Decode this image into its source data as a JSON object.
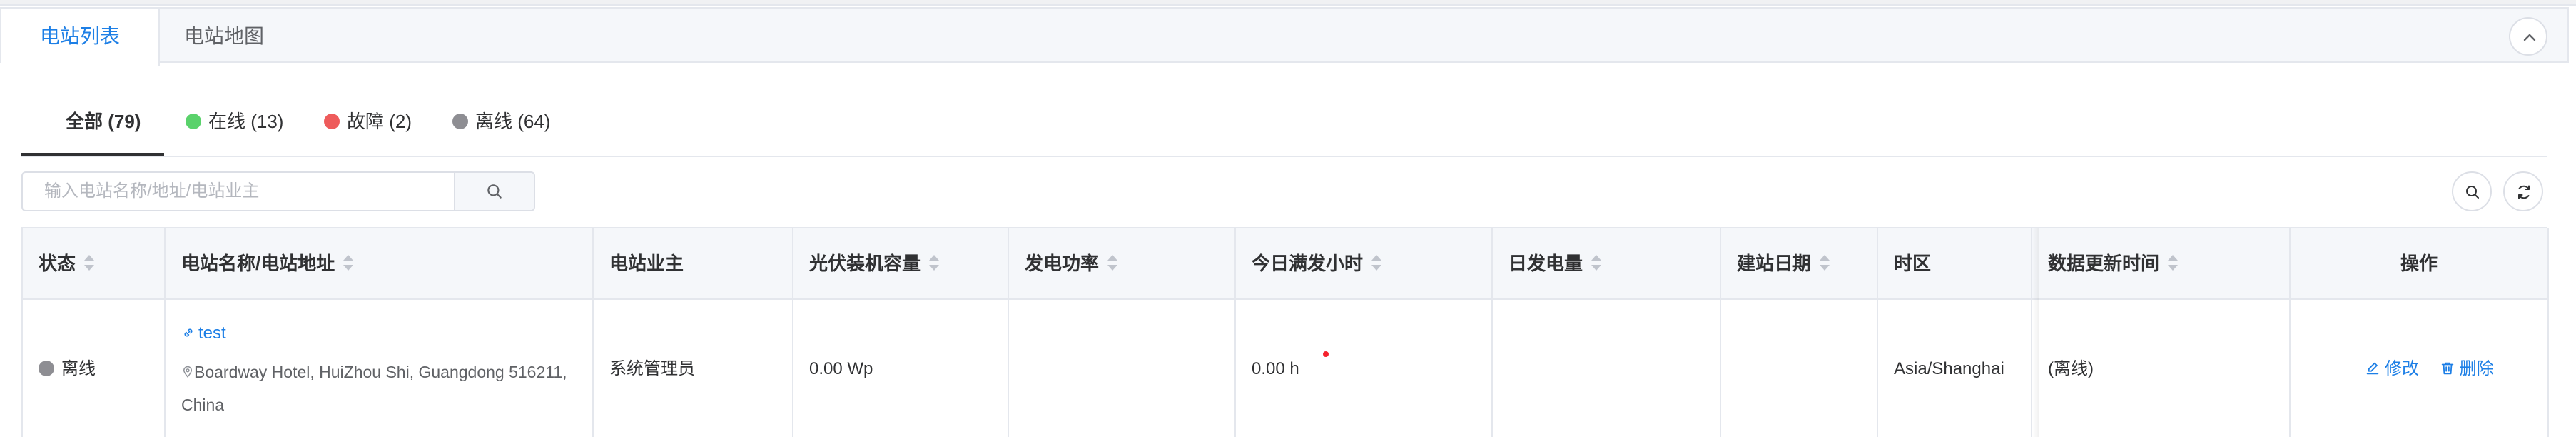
{
  "header_tabs": [
    {
      "label": "电站列表",
      "active": true
    },
    {
      "label": "电站地图",
      "active": false
    }
  ],
  "filters": {
    "all": "全部 (79)",
    "online": "在线 (13)",
    "fault": "故障 (2)",
    "offline": "离线 (64)"
  },
  "status_colors": {
    "online": "#5ad26b",
    "fault": "#ee5b5b",
    "offline": "#8e8e93",
    "accent": "#1d7fe6"
  },
  "search": {
    "placeholder": "输入电站名称/地址/电站业主",
    "value": ""
  },
  "table": {
    "columns": [
      "状态",
      "电站名称/电站地址",
      "电站业主",
      "光伏装机容量",
      "发电功率",
      "今日满发小时",
      "日发电量",
      "建站日期",
      "时区",
      "数据更新时间",
      "操作"
    ],
    "rows": [
      {
        "status": "离线",
        "name": "test",
        "address": "Boardway Hotel, HuiZhou Shi, Guangdong 516211, China",
        "owner": "系统管理员",
        "capacity": "0.00 Wp",
        "power": "",
        "full_hours": "0.00 h",
        "daily_energy": "",
        "build_date": "",
        "timezone": "Asia/Shanghai",
        "updated": "(离线)",
        "edit": "修改",
        "delete": "删除"
      }
    ]
  },
  "icons": {
    "collapse": "chevron-up-icon",
    "search": "search-icon",
    "refresh": "refresh-icon",
    "link": "link-icon",
    "location": "location-pin-icon",
    "edit": "edit-icon",
    "delete": "trash-icon"
  }
}
